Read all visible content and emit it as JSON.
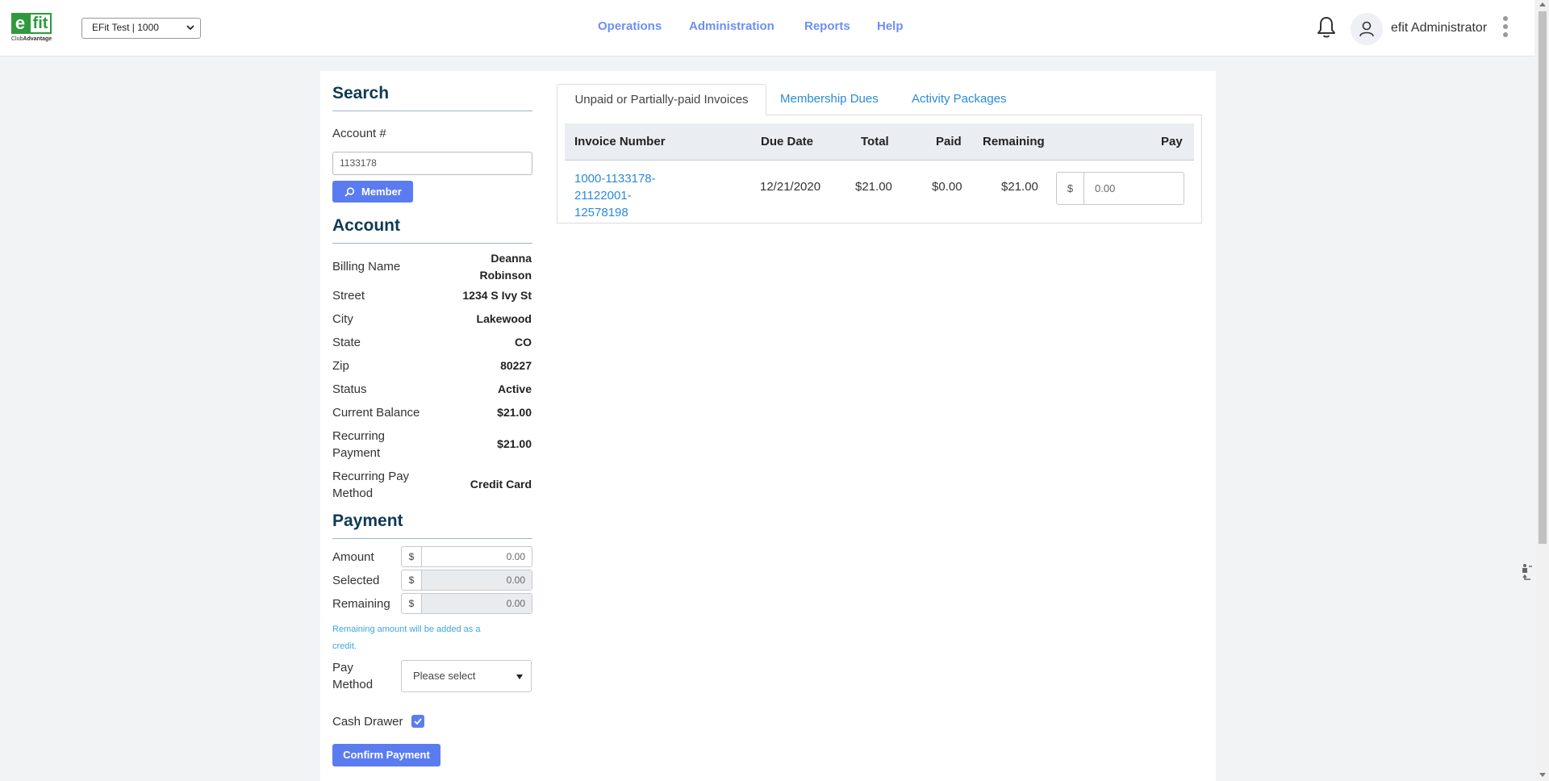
{
  "header": {
    "logo_text_e": "e",
    "logo_text_fit": "fit",
    "logo_sub_prefix": "Club",
    "logo_sub_bold": "Advantage",
    "club_select_value": "EFit Test | 1000",
    "nav": [
      "Operations",
      "Administration",
      "Reports",
      "Help"
    ],
    "user_name": "efit Administrator"
  },
  "search": {
    "heading": "Search",
    "account_label": "Account #",
    "account_value": "1133178",
    "member_button": "Member"
  },
  "account": {
    "heading": "Account",
    "fields": [
      {
        "label": "Billing Name",
        "value_line1": "Deanna",
        "value_line2": "Robinson"
      },
      {
        "label": "Street",
        "value": "1234 S Ivy St"
      },
      {
        "label": "City",
        "value": "Lakewood"
      },
      {
        "label": "State",
        "value": "CO"
      },
      {
        "label": "Zip",
        "value": "80227"
      },
      {
        "label": "Status",
        "value": "Active"
      },
      {
        "label": "Current Balance",
        "value": "$21.00"
      },
      {
        "label_line1": "Recurring",
        "label_line2": "Payment",
        "value": "$21.00"
      },
      {
        "label_line1": "Recurring Pay",
        "label_line2": "Method",
        "value": "Credit Card"
      }
    ]
  },
  "payment": {
    "heading": "Payment",
    "currency": "$",
    "amount_label": "Amount",
    "amount_value": "0.00",
    "selected_label": "Selected",
    "selected_value": "0.00",
    "remaining_label": "Remaining",
    "remaining_value": "0.00",
    "note_line1": "Remaining amount will be added as a",
    "note_line2": "credit.",
    "pay_method_label_line1": "Pay",
    "pay_method_label_line2": "Method",
    "pay_method_value": "Please select",
    "cash_drawer_label": "Cash Drawer",
    "cash_drawer_checked": true,
    "confirm_button": "Confirm Payment"
  },
  "tabs": {
    "items": [
      "Unpaid or Partially-paid Invoices",
      "Membership Dues",
      "Activity Packages"
    ],
    "active_index": 0
  },
  "invoices": {
    "columns": [
      "Invoice Number",
      "Due Date",
      "Total",
      "Paid",
      "Remaining",
      "Pay"
    ],
    "rows": [
      {
        "invoice_line1": "1000-1133178-21122001-",
        "invoice_line2": "12578198",
        "due_date": "12/21/2020",
        "total": "$21.00",
        "paid": "$0.00",
        "remaining": "$21.00",
        "pay_currency": "$",
        "pay_value": "0.00"
      }
    ]
  },
  "colors": {
    "accent": "#5b7cf0",
    "nav_link": "#6f8ef2",
    "heading": "#0f3a53",
    "link": "#2a8ad8",
    "logo_green": "#2e9a3d"
  }
}
